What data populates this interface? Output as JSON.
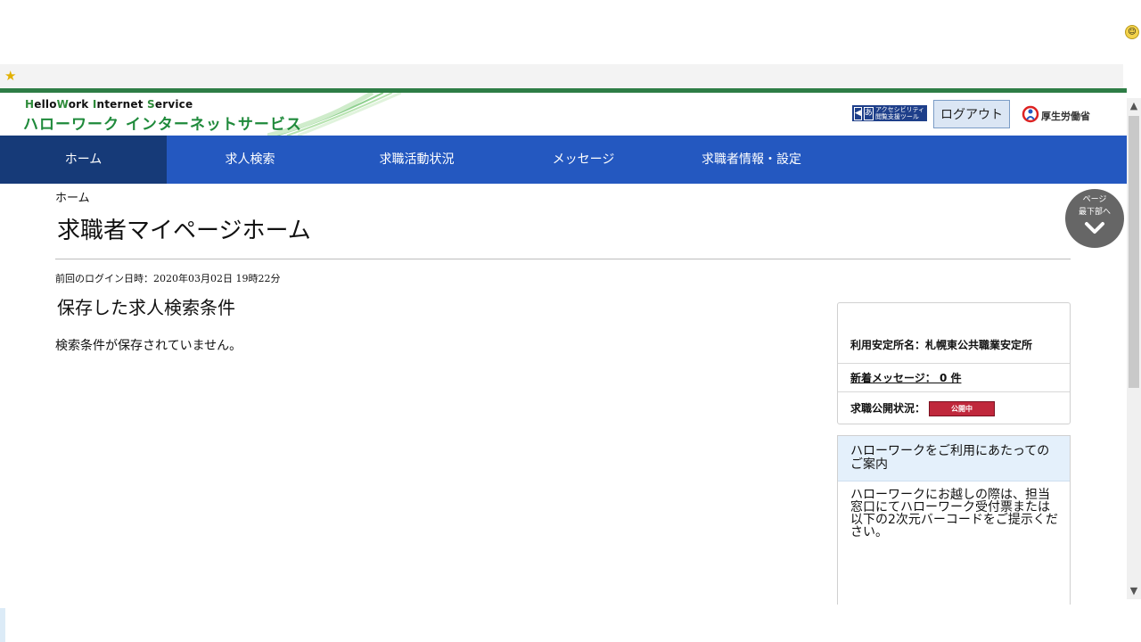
{
  "header": {
    "logo_en_parts": [
      "H",
      "ello",
      "W",
      "ork ",
      "I",
      "nternet ",
      "S",
      "ervice"
    ],
    "logo_jp": "ハローワーク インターネットサービス",
    "accessibility_label": "アクセシビリティ 閲覧支援ツール",
    "accessibility_glyph": "あ",
    "logout_label": "ログアウト",
    "mhlw_label": "厚生労働省"
  },
  "nav": {
    "items": [
      {
        "label": "ホーム"
      },
      {
        "label": "求人検索"
      },
      {
        "label": "求職活動状況"
      },
      {
        "label": "メッセージ"
      },
      {
        "label": "求職者情報・設定"
      }
    ]
  },
  "main": {
    "breadcrumb": "ホーム",
    "page_title": "求職者マイページホーム",
    "last_login": "前回のログイン日時：2020年03月02日 19時22分",
    "saved_search_title": "保存した求人検索条件",
    "saved_search_empty": "検索条件が保存されていません。"
  },
  "to_bottom": {
    "line1": "ページ",
    "line2": "最下部へ"
  },
  "info": {
    "office": "利用安定所名：札幌東公共職業安定所",
    "new_messages": "新着メッセージ：  0 件",
    "status_label": "求職公開状況：",
    "status_badge": "公開中"
  },
  "guide": {
    "title": "ハローワークをご利用にあたってのご案内",
    "body": "ハローワークにお越しの際は、担当窓口にてハローワーク受付票または以下の2次元バーコードをご提示ください。"
  },
  "colors": {
    "nav_bg": "#2458c0",
    "nav_active": "#163a78",
    "brand_green": "#1f8a3b",
    "badge_red": "#c0283c"
  }
}
